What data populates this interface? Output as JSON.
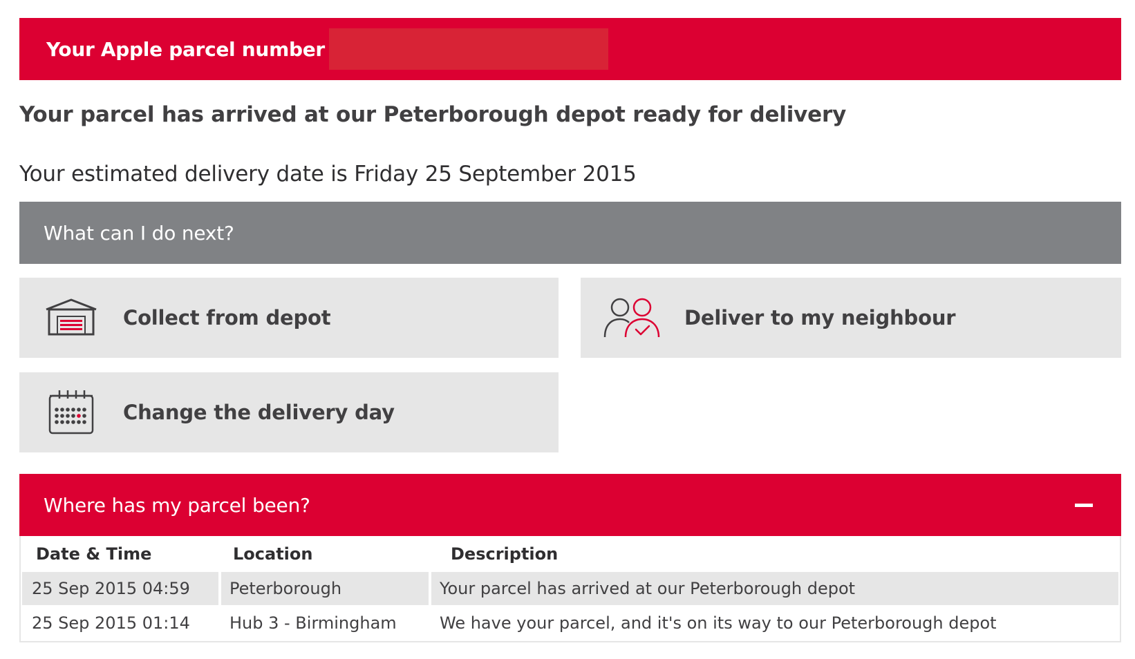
{
  "header": {
    "parcel_label": "Your Apple parcel number"
  },
  "status": {
    "message": "Your parcel has arrived at our Peterborough depot ready for delivery",
    "eta": "Your estimated delivery date is Friday 25 September 2015"
  },
  "next": {
    "title": "What can I do next?",
    "options": [
      {
        "label": "Collect from depot",
        "icon": "depot-icon"
      },
      {
        "label": "Deliver to my neighbour",
        "icon": "neighbour-icon"
      },
      {
        "label": "Change the delivery day",
        "icon": "calendar-icon"
      }
    ]
  },
  "history": {
    "title": "Where has my parcel been?",
    "collapse_icon": "minus-icon",
    "columns": [
      "Date & Time",
      "Location",
      "Description"
    ],
    "rows": [
      {
        "datetime": "25 Sep 2015 04:59",
        "location": "Peterborough",
        "description": "Your parcel has arrived at our Peterborough depot"
      },
      {
        "datetime": "25 Sep 2015 01:14",
        "location": "Hub 3 - Birmingham",
        "description": "We have your parcel, and it's on its way to our Peterborough depot"
      }
    ]
  },
  "colors": {
    "brand_red": "#dc0032",
    "grey_bar": "#808285",
    "tile_bg": "#e6e6e6",
    "text": "#414042"
  }
}
